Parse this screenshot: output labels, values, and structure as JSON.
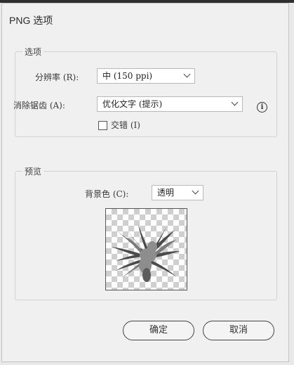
{
  "dialog": {
    "title": "PNG 选项",
    "options": {
      "legend": "选项",
      "resolution_label": "分辨率 (R):",
      "resolution_value": "中 (150 ppi)",
      "antialias_label": "消除锯齿 (A):",
      "antialias_value": "优化文字 (提示)",
      "interlace_label": "交错 (I)",
      "interlace_checked": false
    },
    "preview": {
      "legend": "预览",
      "background_label": "背景色 (C):",
      "background_value": "透明"
    },
    "buttons": {
      "ok": "确定",
      "cancel": "取消"
    }
  }
}
